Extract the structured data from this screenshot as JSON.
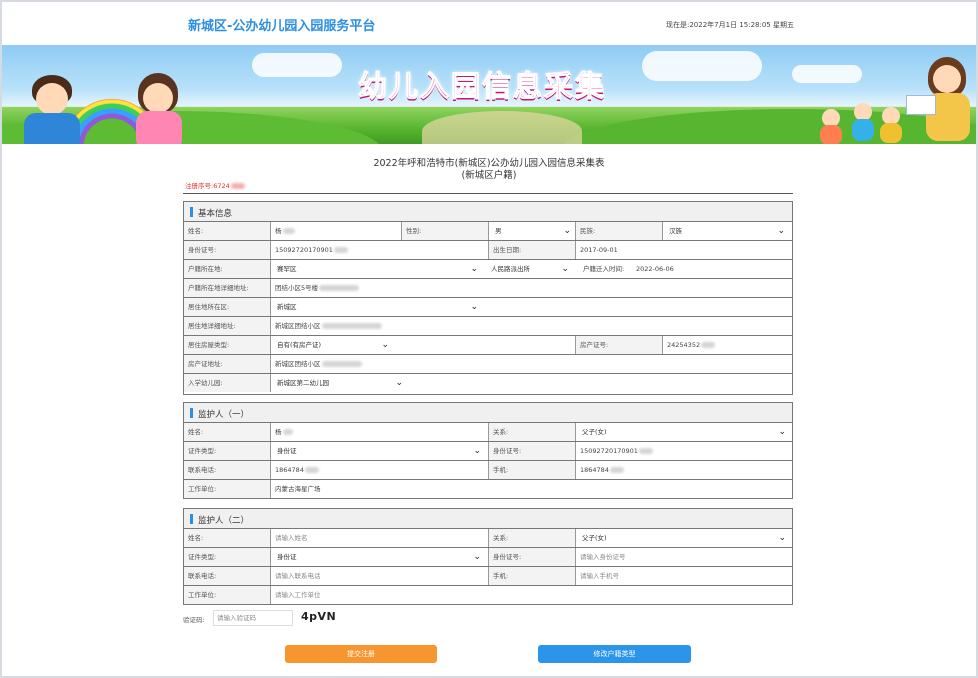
{
  "header": {
    "site_title": "新城区-公办幼儿园入园服务平台",
    "clock": "现在是:2022年7月1日 15:28:05 星期五"
  },
  "banner": {
    "title": "幼儿入园信息采集"
  },
  "form": {
    "title_line1": "2022年呼和浩特市(新城区)公办幼儿园入园信息采集表",
    "title_line2": "(新城区户籍)",
    "serial": "注册序号:6724"
  },
  "basic": {
    "section_title": "基本信息",
    "name_label": "姓名:",
    "name_value": "杨",
    "gender_label": "性别:",
    "gender_value": "男",
    "ethnic_label": "民族:",
    "ethnic_value": "汉族",
    "id_label": "身份证号:",
    "id_value": "15092720170901",
    "birth_label": "出生日期:",
    "birth_value": "2017-09-01",
    "hukou_label": "户籍所在地:",
    "hukou_district": "赛罕区",
    "hukou_police": "人民路派出所",
    "hukou_time_label": "户籍迁入时间:",
    "hukou_time_value": "2022-06-06",
    "hukou_addr_label": "户籍所在地详细地址:",
    "hukou_addr_value": "团结小区5号楼",
    "live_district_label": "居住地所在区:",
    "live_district_value": "新城区",
    "live_addr_label": "居住地详细地址:",
    "live_addr_value": "新城区团结小区",
    "house_type_label": "居住房屋类型:",
    "house_type_value": "自有(有房产证)",
    "cert_no_label": "房产证号:",
    "cert_no_value": "24254352",
    "cert_addr_label": "房产证地址:",
    "cert_addr_value": "新城区团结小区",
    "kinder_label": "入学幼儿园:",
    "kinder_value": "新城区第二幼儿园"
  },
  "guardian1": {
    "section_title": "监护人（一）",
    "name_label": "姓名:",
    "name_value": "杨",
    "relation_label": "关系:",
    "relation_value": "父子(女)",
    "doc_type_label": "证件类型:",
    "doc_type_value": "身份证",
    "id_label": "身份证号:",
    "id_value": "15092720170901",
    "phone_label": "联系电话:",
    "phone_value": "1864784",
    "mobile_label": "手机:",
    "mobile_value": "1864784",
    "work_label": "工作单位:",
    "work_value": "内蒙古海星广场"
  },
  "guardian2": {
    "section_title": "监护人（二）",
    "name_label": "姓名:",
    "name_placeholder": "请输入姓名",
    "relation_label": "关系:",
    "relation_value": "父子(女)",
    "doc_type_label": "证件类型:",
    "doc_type_value": "身份证",
    "id_label": "身份证号:",
    "id_placeholder": "请输入身份证号",
    "phone_label": "联系电话:",
    "phone_placeholder": "请输入联系电话",
    "mobile_label": "手机:",
    "mobile_placeholder": "请输入手机号",
    "work_label": "工作单位:",
    "work_placeholder": "请输入工作单位"
  },
  "captcha": {
    "label": "验证码:",
    "placeholder": "请输入验证码",
    "code": "4pVN"
  },
  "actions": {
    "submit": "提交注册",
    "change_type": "修改户籍类型"
  },
  "colors": {
    "accent_blue": "#2d8fe0",
    "submit_orange": "#f7962e",
    "serial_red": "#e0322e"
  }
}
